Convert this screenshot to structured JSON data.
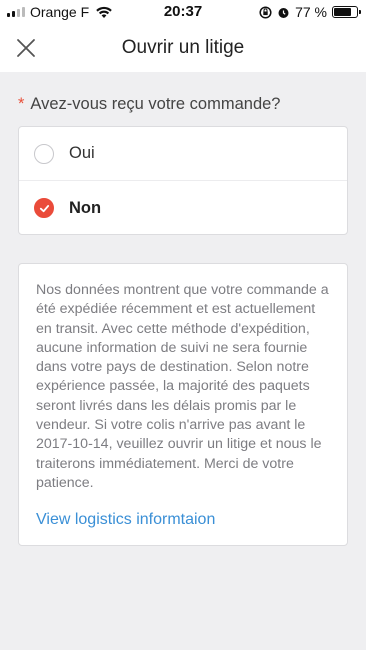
{
  "status_bar": {
    "carrier": "Orange F",
    "time": "20:37",
    "battery_percent": "77 %",
    "battery_level": 0.77
  },
  "header": {
    "title": "Ouvrir un litige"
  },
  "question": {
    "required_mark": "*",
    "text": "Avez-vous reçu votre commande?"
  },
  "options": [
    {
      "label": "Oui",
      "selected": false
    },
    {
      "label": "Non",
      "selected": true
    }
  ],
  "info": {
    "message": "Nos données montrent que votre commande a été expédiée récemment et est actuellement en transit. Avec cette méthode d'expédition, aucune information de suivi ne sera fournie dans votre pays de destination. Selon notre expérience passée, la majorité des paquets seront livrés dans les délais promis par le vendeur. Si votre colis n'arrive pas avant le 2017-10-14, veuillez ouvrir un litige et nous le traiterons immédiatement. Merci de votre patience.",
    "link_label": "View logistics informtaion"
  },
  "colors": {
    "accent": "#ea4b3a",
    "link": "#3a8fd6",
    "background": "#efeff1"
  }
}
